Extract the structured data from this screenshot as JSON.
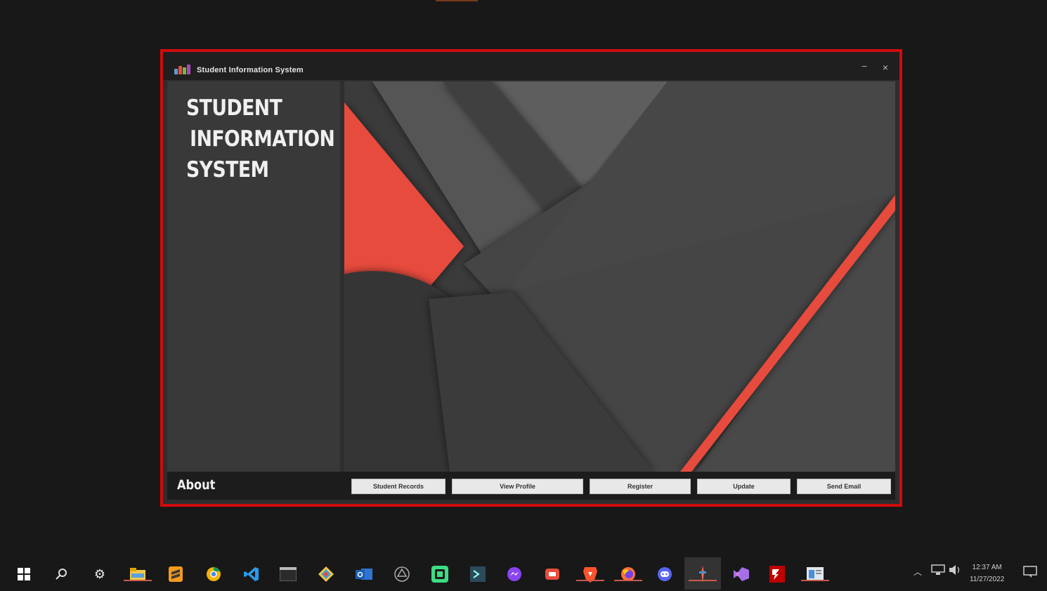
{
  "window": {
    "title": "Student Information System",
    "minimize_glyph": "–",
    "close_glyph": "×"
  },
  "sidebar": {
    "brand_lines": [
      "STUDENT",
      "INFORMATION",
      "SYSTEM"
    ]
  },
  "bottom": {
    "about_label": "About",
    "buttons": [
      "Student Records",
      "View Profile",
      "Register",
      "Update",
      "Send Email"
    ]
  },
  "taskbar": {
    "icons": [
      "windows-start-icon",
      "search-icon",
      "settings-icon",
      "file-explorer-icon",
      "sublime-icon",
      "chrome-canary-icon",
      "vscode-icon",
      "terminal-icon",
      "git-kraken-icon",
      "outlook-icon",
      "unity-icon",
      "android-studio-icon",
      "powershell-icon",
      "messenger-icon",
      "screen-recorder-icon",
      "brave-icon",
      "firefox-icon",
      "discord-icon",
      "java-app-icon",
      "visual-studio-icon",
      "filezilla-icon",
      "notepad-app-icon"
    ],
    "clock_time": "12:37 AM",
    "clock_date": "11/27/2022"
  },
  "colors": {
    "accent_red": "#e74c3c",
    "window_border": "#d10b0b",
    "bg_dark": "#181818"
  }
}
